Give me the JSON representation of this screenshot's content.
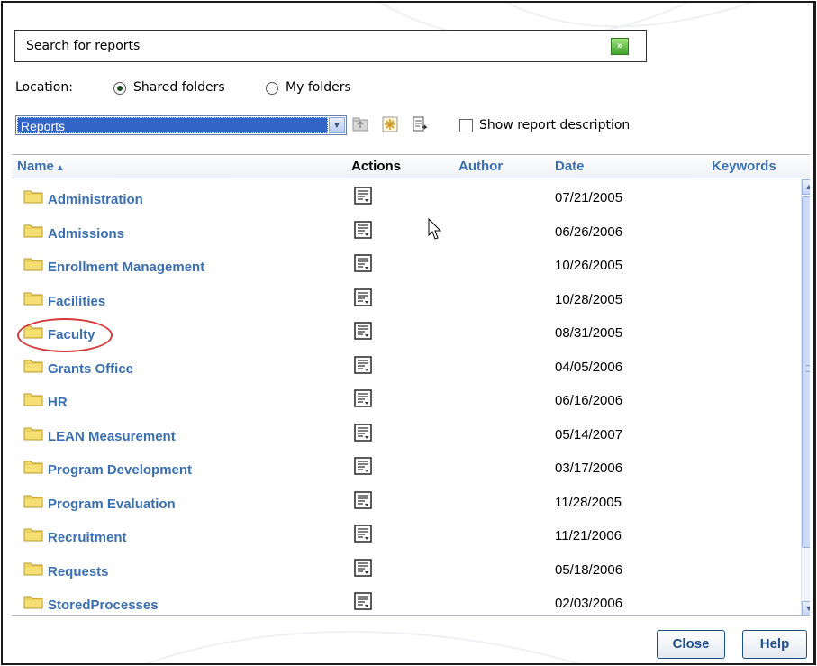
{
  "search": {
    "label": "Search for reports",
    "expand_icon": "double-chevron-down-icon"
  },
  "location": {
    "label": "Location:",
    "options": [
      {
        "label": "Shared folders",
        "selected": true
      },
      {
        "label": "My folders",
        "selected": false
      }
    ]
  },
  "folder_select": {
    "value": "Reports"
  },
  "toolbar": {
    "up_folder_icon": "folder-up-icon",
    "new_folder_icon": "new-item-icon",
    "refresh_icon": "refresh-icon",
    "show_description_label": "Show report description",
    "show_description_checked": false
  },
  "columns": {
    "name": "Name",
    "actions": "Actions",
    "author": "Author",
    "date": "Date",
    "keywords": "Keywords"
  },
  "rows": [
    {
      "name": "Administration",
      "date": "07/21/2005"
    },
    {
      "name": "Admissions",
      "date": "06/26/2006"
    },
    {
      "name": "Enrollment Management",
      "date": "10/26/2005"
    },
    {
      "name": "Facilities",
      "date": "10/28/2005"
    },
    {
      "name": "Faculty",
      "date": "08/31/2005"
    },
    {
      "name": "Grants Office",
      "date": "04/05/2006"
    },
    {
      "name": "HR",
      "date": "06/16/2006"
    },
    {
      "name": "LEAN Measurement",
      "date": "05/14/2007"
    },
    {
      "name": "Program Development",
      "date": "03/17/2006"
    },
    {
      "name": "Program Evaluation",
      "date": "11/28/2005"
    },
    {
      "name": "Recruitment",
      "date": "11/21/2006"
    },
    {
      "name": "Requests",
      "date": "05/18/2006"
    },
    {
      "name": "StoredProcesses",
      "date": "02/03/2006"
    }
  ],
  "buttons": {
    "close": "Close",
    "help": "Help"
  },
  "colors": {
    "link": "#3a6fb0",
    "select_highlight": "#3164c7",
    "annotation": "#d33a3a"
  }
}
